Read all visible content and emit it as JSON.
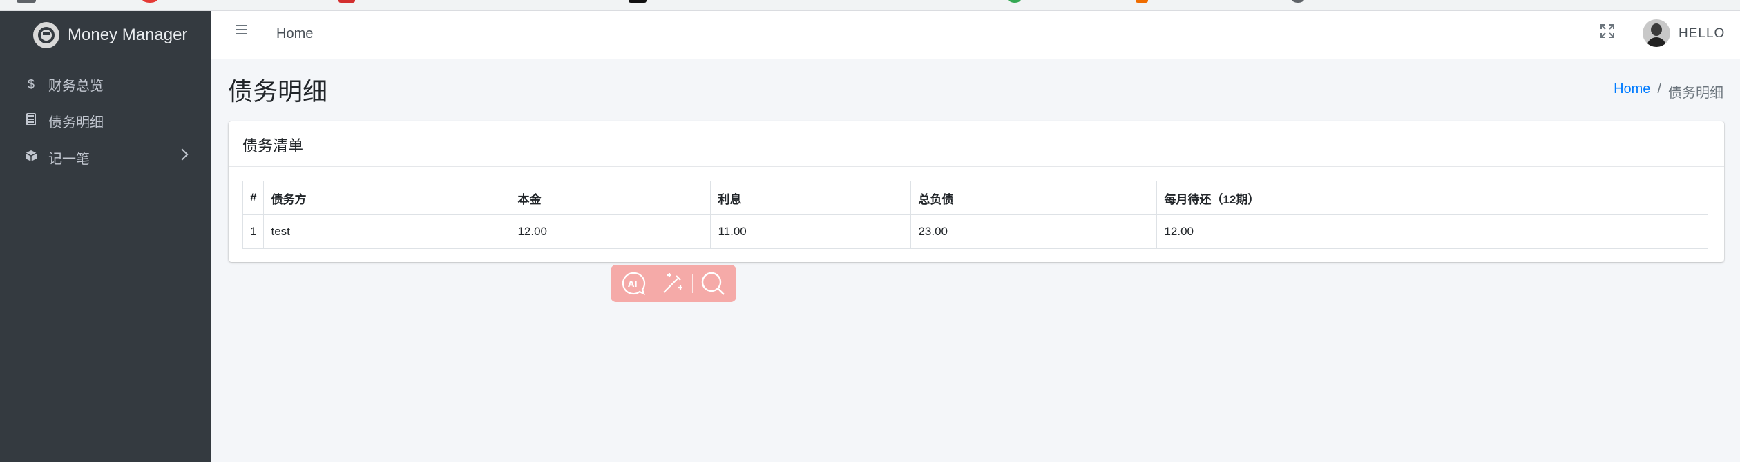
{
  "app": {
    "brand": "Money Manager"
  },
  "sidebar": {
    "items": [
      {
        "label": "财务总览",
        "icon": "dollar-icon"
      },
      {
        "label": "债务明细",
        "icon": "calculator-icon"
      },
      {
        "label": "记一笔",
        "icon": "cube-icon",
        "has_submenu": true
      }
    ]
  },
  "header": {
    "nav_home": "Home",
    "user_greeting": "HELLO"
  },
  "page": {
    "title": "债务明细",
    "breadcrumb": {
      "home": "Home",
      "separator": "/",
      "current": "债务明细"
    }
  },
  "card": {
    "title": "债务清单",
    "table": {
      "columns": [
        "#",
        "债务方",
        "本金",
        "利息",
        "总负债",
        "每月待还（12期）"
      ],
      "rows": [
        [
          "1",
          "test",
          "12.00",
          "11.00",
          "23.00",
          "12.00"
        ]
      ]
    }
  },
  "floating_toolbar": {
    "icons": [
      "ai-chat-icon",
      "magic-wand-icon",
      "search-icon"
    ],
    "color": "#f5aaa8"
  },
  "colors": {
    "sidebar_bg": "#343a40",
    "link": "#007bff",
    "content_bg": "#f4f6f9"
  }
}
